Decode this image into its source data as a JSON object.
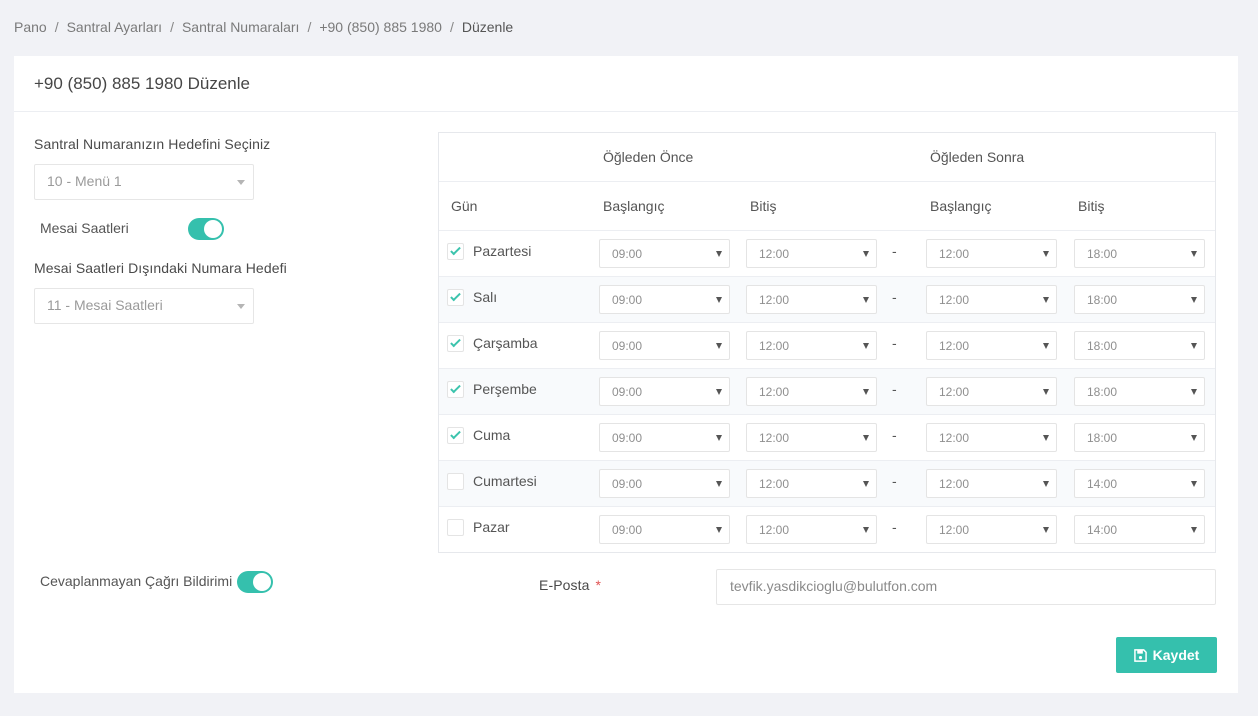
{
  "breadcrumb": [
    "Pano",
    "Santral Ayarları",
    "Santral Numaraları",
    "+90 (850) 885 1980",
    "Düzenle"
  ],
  "card": {
    "title": "+90 (850) 885 1980 Düzenle"
  },
  "form": {
    "target_label": "Santral Numaranızın Hedefini Seçiniz",
    "target_value": "10 - Menü 1",
    "working_hours_label": "Mesai Saatleri",
    "working_hours_enabled": true,
    "outside_label": "Mesai Saatleri Dışındaki Numara Hedefi",
    "outside_value": "11 - Mesai Saatleri",
    "missed_call_label": "Cevaplanmayan Çağrı Bildirimi",
    "missed_call_enabled": true,
    "email_label": "E-Posta",
    "email_required_mark": "*",
    "email_value": "tevfik.yasdikcioglu@bulutfon.com",
    "save_label": "Kaydet"
  },
  "schedule": {
    "morning_header": "Öğleden Önce",
    "afternoon_header": "Öğleden Sonra",
    "col_day": "Gün",
    "col_start": "Başlangıç",
    "col_end": "Bitiş",
    "separator": "-",
    "days": [
      {
        "name": "Pazartesi",
        "checked": true,
        "am_start": "09:00",
        "am_end": "12:00",
        "pm_start": "12:00",
        "pm_end": "18:00"
      },
      {
        "name": "Salı",
        "checked": true,
        "am_start": "09:00",
        "am_end": "12:00",
        "pm_start": "12:00",
        "pm_end": "18:00"
      },
      {
        "name": "Çarşamba",
        "checked": true,
        "am_start": "09:00",
        "am_end": "12:00",
        "pm_start": "12:00",
        "pm_end": "18:00"
      },
      {
        "name": "Perşembe",
        "checked": true,
        "am_start": "09:00",
        "am_end": "12:00",
        "pm_start": "12:00",
        "pm_end": "18:00"
      },
      {
        "name": "Cuma",
        "checked": true,
        "am_start": "09:00",
        "am_end": "12:00",
        "pm_start": "12:00",
        "pm_end": "18:00"
      },
      {
        "name": "Cumartesi",
        "checked": false,
        "am_start": "09:00",
        "am_end": "12:00",
        "pm_start": "12:00",
        "pm_end": "14:00"
      },
      {
        "name": "Pazar",
        "checked": false,
        "am_start": "09:00",
        "am_end": "12:00",
        "pm_start": "12:00",
        "pm_end": "14:00"
      }
    ]
  },
  "colors": {
    "accent": "#35c0ad",
    "required": "#e05353",
    "background": "#f1f2f6"
  }
}
